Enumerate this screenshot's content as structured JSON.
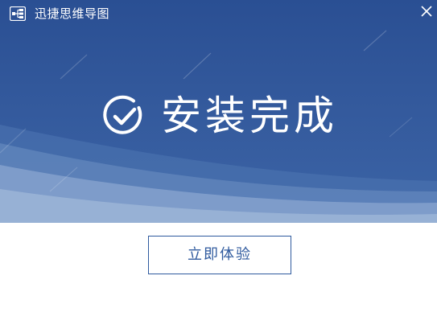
{
  "window": {
    "title": "迅捷思维导图",
    "close_symbol": "×"
  },
  "icons": {
    "app_logo": "mindmap-logo-icon",
    "close": "close-icon",
    "success": "check-circle-icon"
  },
  "main": {
    "status_text": "安装完成",
    "action_label": "立即体验"
  },
  "colors": {
    "hero_top": "#2a4f93",
    "hero_bottom": "#3c64a6",
    "wave_light": "#8aa6d0",
    "button_border": "#2f5a9e",
    "button_text": "#2f5a9e",
    "background": "#ffffff"
  }
}
